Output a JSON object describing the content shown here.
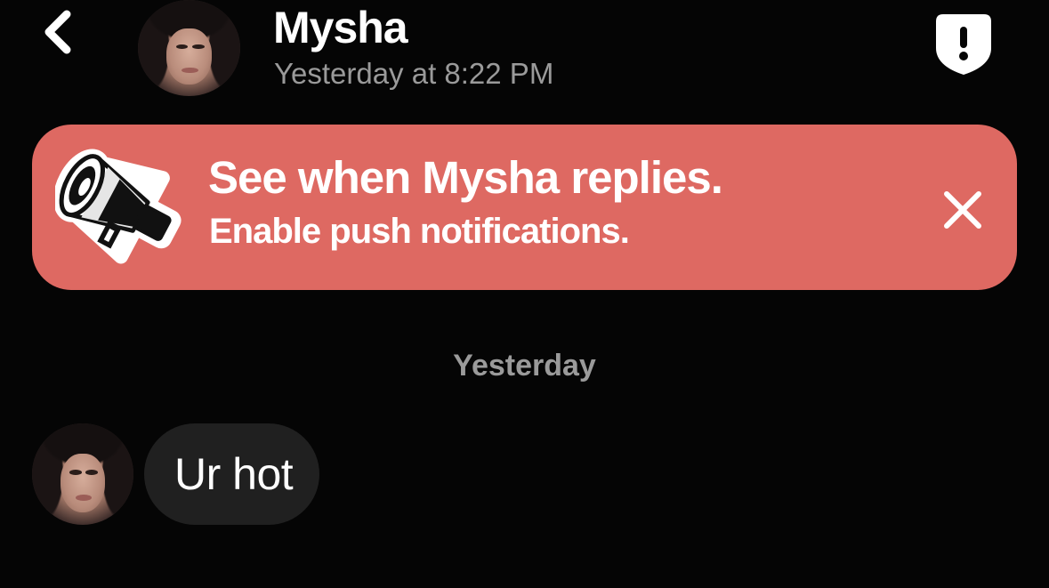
{
  "header": {
    "back_icon": "chevron-left-icon",
    "contact_name": "Mysha",
    "last_seen": "Yesterday at 8:22 PM",
    "report_icon": "shield-exclamation-icon"
  },
  "banner": {
    "icon": "megaphone-icon",
    "title": "See when Mysha replies.",
    "subtitle": "Enable push notifications.",
    "close_icon": "close-icon",
    "background_color": "#de6962"
  },
  "conversation": {
    "date_separator": "Yesterday",
    "messages": [
      {
        "sender": "Mysha",
        "text": "Ur hot"
      }
    ]
  },
  "colors": {
    "background": "#050505",
    "secondary_text": "#9a9a9a",
    "bubble": "#202020"
  }
}
